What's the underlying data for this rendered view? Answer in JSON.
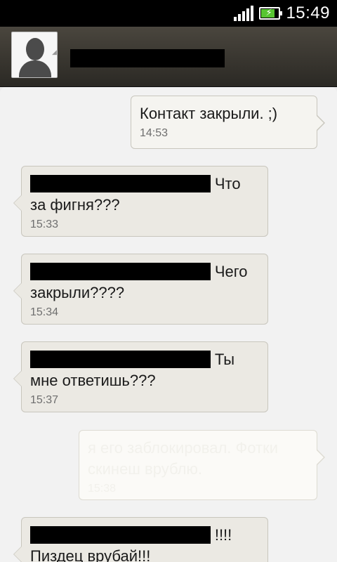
{
  "status_bar": {
    "time": "15:49",
    "battery_level": 0.7
  },
  "header": {
    "contact_name": "██████████████"
  },
  "messages": [
    {
      "direction": "outgoing",
      "text": "Контакт закрыли. ;)",
      "time": "14:53"
    },
    {
      "direction": "incoming",
      "sender": "████████████████:",
      "text": " Что за фигня???",
      "time": "15:33"
    },
    {
      "direction": "incoming",
      "sender": "████████████████:",
      "text": " Чего закрыли????",
      "time": "15:34"
    },
    {
      "direction": "incoming",
      "sender": "████████████████:",
      "text": "  Ты мне ответишь???",
      "time": "15:37"
    },
    {
      "direction": "outgoing",
      "text": "я его заблокировал. Фотки скинеш врублю.",
      "time": "15:38"
    },
    {
      "direction": "incoming",
      "sender": "████████████████:",
      "text": " !!!! Пиздец врубай!!!",
      "time": ""
    }
  ]
}
